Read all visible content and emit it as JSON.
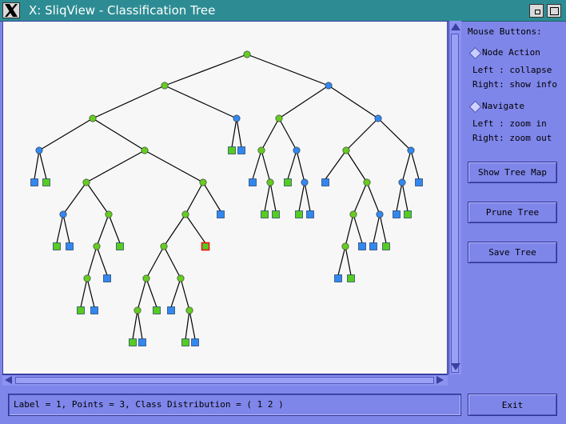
{
  "window": {
    "title": "X: SliqView - Classification Tree"
  },
  "sidebar": {
    "heading": "Mouse Buttons:",
    "node_action": {
      "label": "Node Action",
      "left": "Left : collapse",
      "right": "Right: show info"
    },
    "navigate": {
      "label": "Navigate",
      "left": "Left : zoom in",
      "right": "Right: zoom out"
    },
    "buttons": {
      "show_tree_map": "Show Tree Map",
      "prune_tree": "Prune Tree",
      "save_tree": "Save Tree",
      "exit": "Exit"
    }
  },
  "status": {
    "text": "Label = 1, Points = 3, Class Distribution = ( 1 2 )"
  },
  "colors": {
    "node_green": "#66cc22",
    "node_blue": "#3388ee",
    "leaf_green": "#55cc22",
    "leaf_blue": "#3388ee",
    "selected_outline": "#ee1111",
    "edge": "#000000"
  }
}
